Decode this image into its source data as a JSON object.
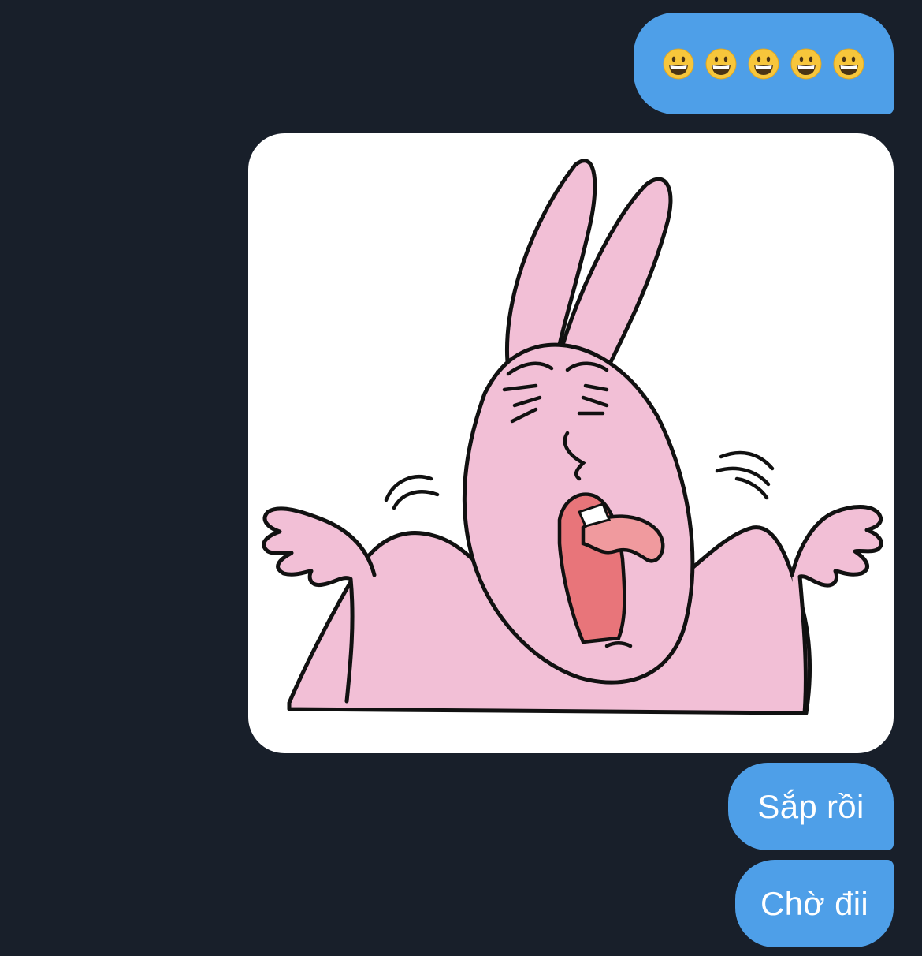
{
  "chat": {
    "messages": [
      {
        "type": "emoji",
        "emojis": [
          "grinning-face-emoji",
          "grinning-face-emoji",
          "grinning-face-emoji",
          "grinning-face-emoji",
          "grinning-face-emoji"
        ]
      },
      {
        "type": "sticker",
        "sticker": "pink-rabbit-shrug-sticker"
      },
      {
        "type": "text",
        "text": "Sắp rồi"
      },
      {
        "type": "text",
        "text": "Chờ đii"
      }
    ]
  },
  "colors": {
    "background": "#181f2a",
    "bubble": "#4e9fe8",
    "bubble_text": "#ffffff",
    "rabbit_pink": "#f2bfd6",
    "tongue": "#e8757a",
    "outline": "#111111"
  }
}
